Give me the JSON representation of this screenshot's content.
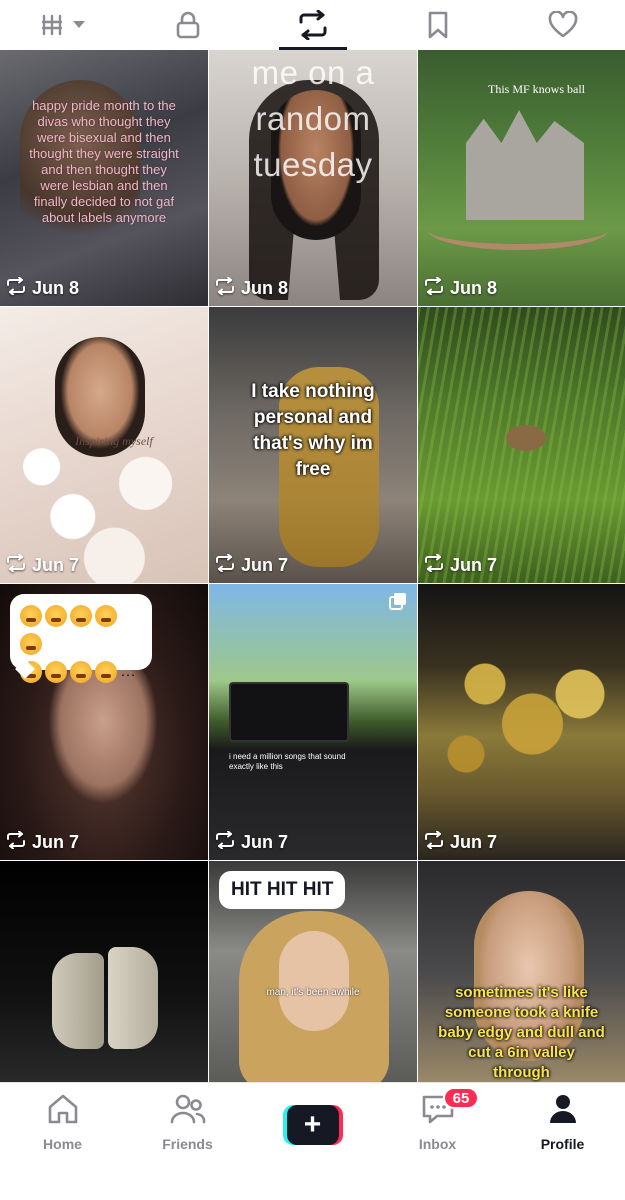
{
  "tabs": [
    {
      "name": "videos-grid",
      "icon": "grid-icon",
      "active": false
    },
    {
      "name": "private",
      "icon": "lock-icon",
      "active": false
    },
    {
      "name": "reposts",
      "icon": "repost-icon",
      "active": true
    },
    {
      "name": "favorites",
      "icon": "bookmark-icon",
      "active": false
    },
    {
      "name": "liked",
      "icon": "heart-icon",
      "active": false
    }
  ],
  "videos": [
    {
      "date": "Jun 8",
      "caption": "happy pride month to the divas who thought they were bisexual and then thought they were straight and then thought they were lesbian and then finally decided to not gaf about labels anymore"
    },
    {
      "date": "Jun 8",
      "caption": "me on a random tuesday"
    },
    {
      "date": "Jun 8",
      "caption": "This MF knows ball"
    },
    {
      "date": "Jun 7",
      "caption": "Inspiring myself"
    },
    {
      "date": "Jun 7",
      "caption": "I take nothing personal and that's why im free"
    },
    {
      "date": "Jun 7",
      "caption": ""
    },
    {
      "date": "Jun 7",
      "caption": "…"
    },
    {
      "date": "Jun 7",
      "caption": "i need a million songs that sound exactly like this"
    },
    {
      "date": "Jun 7",
      "caption": ""
    },
    {
      "date": "",
      "caption": ""
    },
    {
      "date": "",
      "caption": "HIT HIT HIT",
      "subcaption": "man, it's been awhile"
    },
    {
      "date": "",
      "caption": "sometimes it's like someone took a knife baby edgy and dull and cut a 6in valley through"
    }
  ],
  "nav": {
    "home": "Home",
    "friends": "Friends",
    "create": "+",
    "inbox": "Inbox",
    "inbox_badge": "65",
    "profile": "Profile"
  },
  "colors": {
    "text": "#161823",
    "inactive": "#8a8b91",
    "accent_red": "#fe2c55",
    "accent_cyan": "#25f4ee"
  }
}
